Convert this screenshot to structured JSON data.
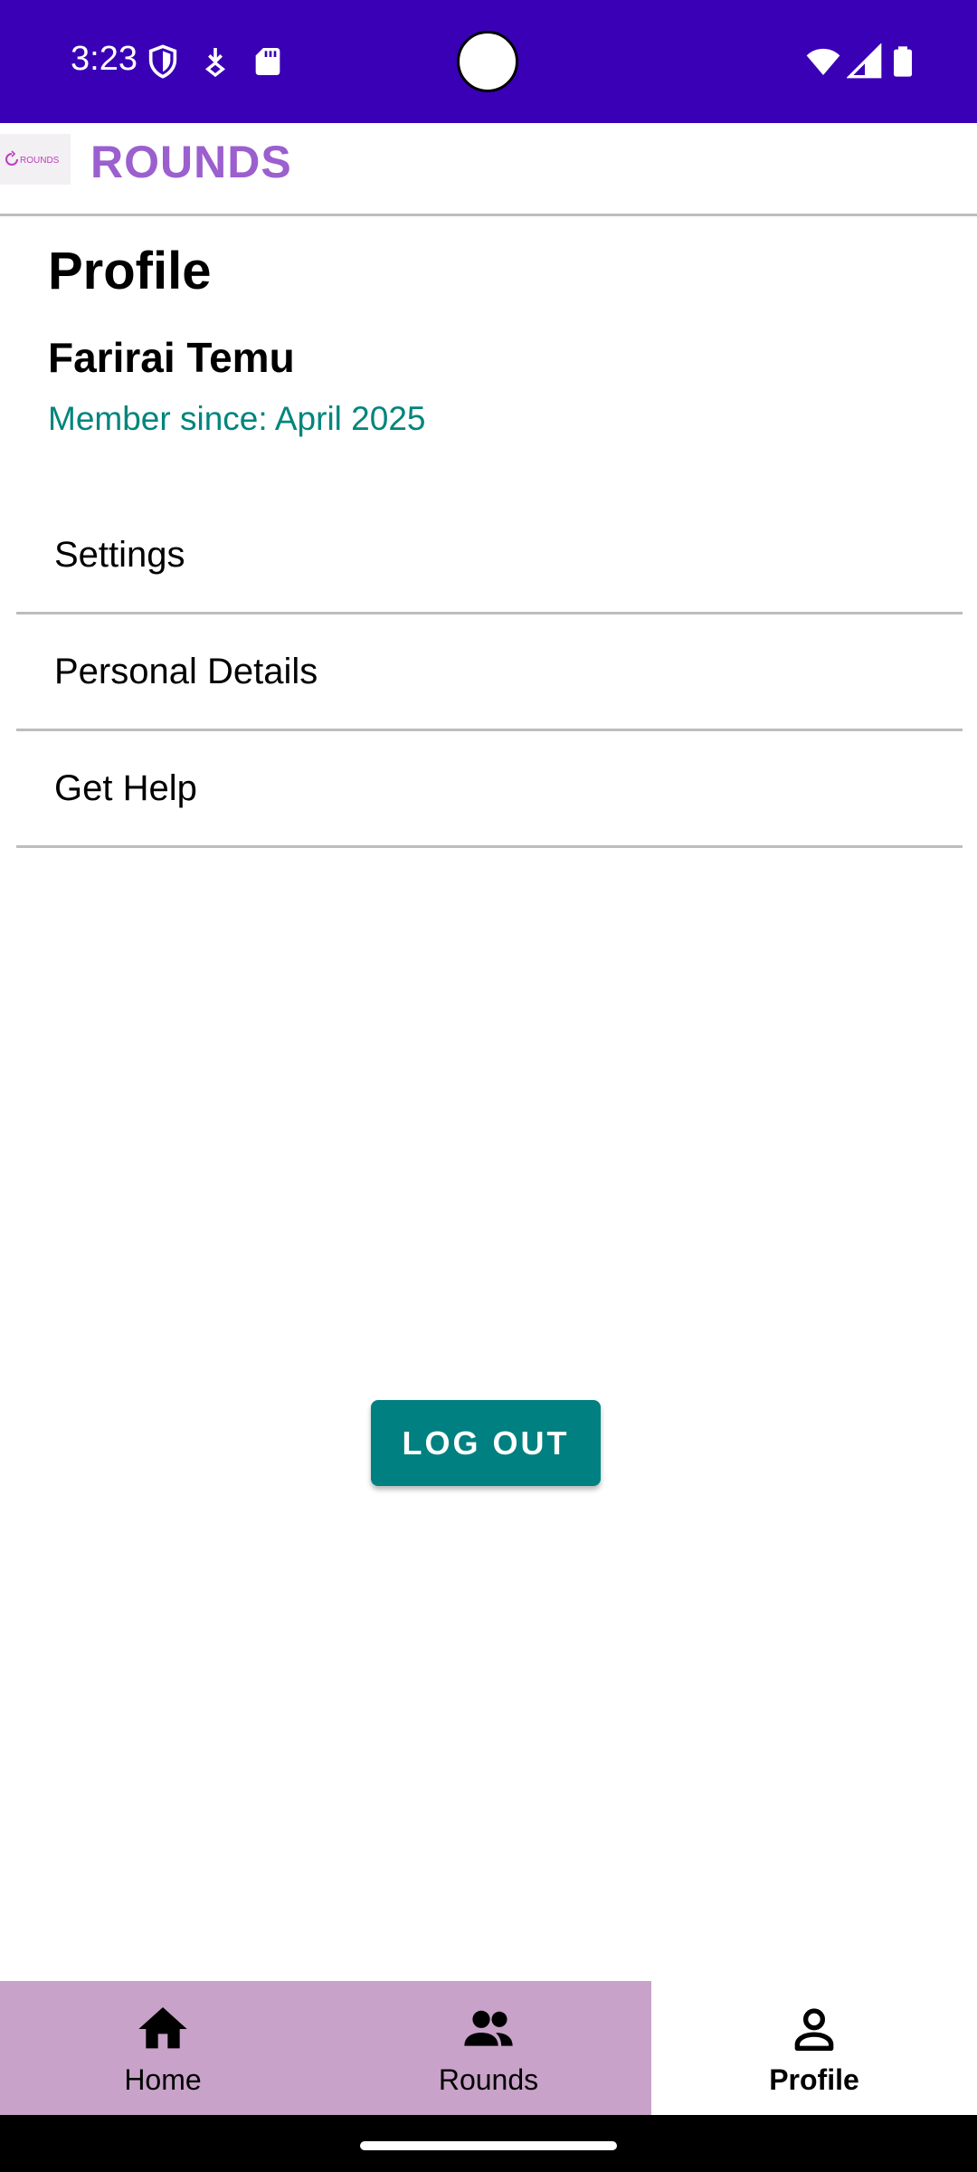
{
  "status_bar": {
    "time": "3:23",
    "background_color": "#3a00b6",
    "left_icons": [
      "shield-icon",
      "download-icon",
      "sd-card-icon"
    ],
    "right_icons": [
      "wifi-icon",
      "signal-icon",
      "battery-icon"
    ]
  },
  "app_bar": {
    "title": "ROUNDS",
    "logo_text": "ROUNDS",
    "title_color": "#9b5fcf"
  },
  "profile": {
    "page_title": "Profile",
    "user_name": "Farirai Temu",
    "member_since": "Member since: April 2025",
    "member_since_color": "#00857c"
  },
  "menu": {
    "items": [
      {
        "label": "Settings"
      },
      {
        "label": "Personal Details"
      },
      {
        "label": "Get Help"
      }
    ]
  },
  "logout": {
    "label": "LOG OUT",
    "color": "#008080"
  },
  "bottom_nav": {
    "items": [
      {
        "label": "Home",
        "icon": "home-icon",
        "active": false
      },
      {
        "label": "Rounds",
        "icon": "group-icon",
        "active": false
      },
      {
        "label": "Profile",
        "icon": "person-icon",
        "active": true
      }
    ],
    "inactive_color": "#c8a2c8",
    "active_color": "#ffffff"
  }
}
